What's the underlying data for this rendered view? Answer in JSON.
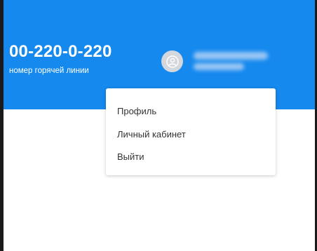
{
  "header": {
    "hotline_phone": "00-220-0-220",
    "hotline_caption": "номер горячей линии",
    "background_color": "#1589ee"
  },
  "user": {
    "avatar_icon": "user-avatar-icon"
  },
  "dropdown": {
    "items": [
      {
        "label": "Профиль"
      },
      {
        "label": "Личный кабинет"
      },
      {
        "label": "Выйти"
      }
    ]
  }
}
